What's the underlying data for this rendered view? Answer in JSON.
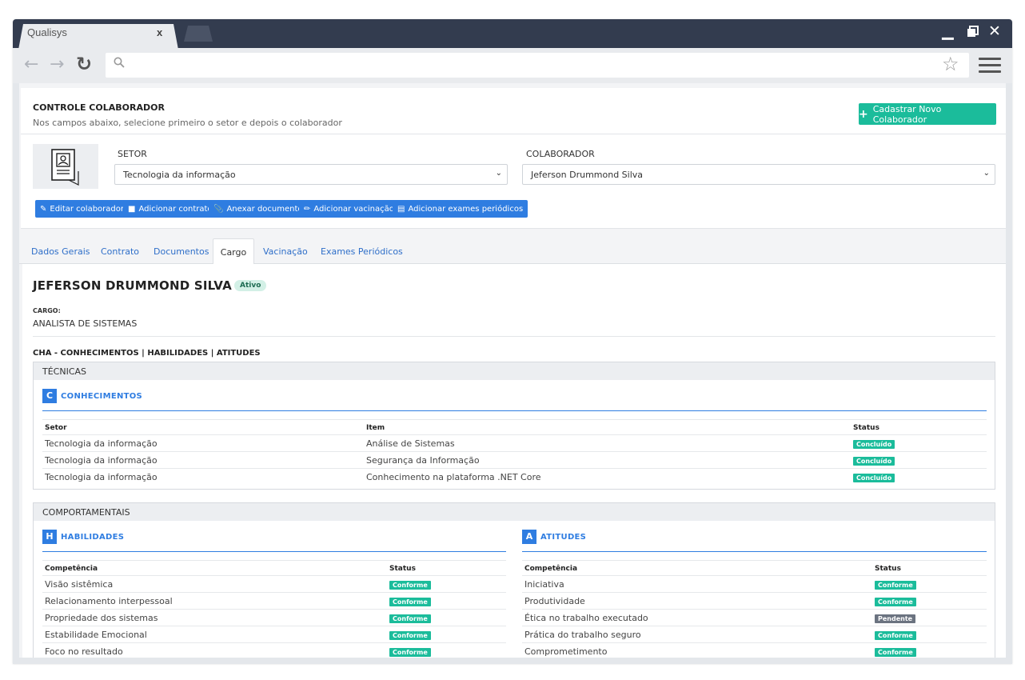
{
  "browser": {
    "tab_title": "Qualisys",
    "tab_close": "x",
    "search_icon": "search-icon"
  },
  "header": {
    "title": "CONTROLE COLABORADOR",
    "subtitle": "Nos campos abaixo, selecione primeiro o setor e depois o colaborador",
    "new_button": "Cadastrar Novo Colaborador"
  },
  "filters": {
    "setor_label": "SETOR",
    "setor_value": "Tecnologia da informação",
    "colaborador_label": "COLABORADOR",
    "colaborador_value": "Jeferson Drummond Silva"
  },
  "actions": [
    {
      "label": "Editar colaborador",
      "icon": "edit-icon"
    },
    {
      "label": "Adicionar contrato",
      "icon": "file-icon"
    },
    {
      "label": "Anexar documento",
      "icon": "paperclip-icon"
    },
    {
      "label": "Adicionar vacinação",
      "icon": "syringe-icon"
    },
    {
      "label": "Adicionar exames periódicos",
      "icon": "calendar-icon"
    }
  ],
  "tabs": [
    "Dados Gerais",
    "Contrato",
    "Documentos",
    "Cargo",
    "Vacinação",
    "Exames Periódicos"
  ],
  "active_tab": "Cargo",
  "employee": {
    "name": "JEFERSON DRUMMOND SILVA",
    "status": "Ativo",
    "cargo_label": "CARGO:",
    "cargo_value": "ANALISTA DE SISTEMAS"
  },
  "cha_title": "CHA - CONHECIMENTOS | HABILIDADES | ATITUDES",
  "tecnicas": {
    "title": "TÉCNICAS",
    "section_letter": "C",
    "section_name": "CONHECIMENTOS",
    "headers": [
      "Setor",
      "Item",
      "Status"
    ],
    "rows": [
      {
        "setor": "Tecnologia da informação",
        "item": "Análise de Sistemas",
        "status": "Concluído"
      },
      {
        "setor": "Tecnologia da informação",
        "item": "Segurança da Informação",
        "status": "Concluído"
      },
      {
        "setor": "Tecnologia da informação",
        "item": "Conhecimento na plataforma .NET Core",
        "status": "Concluído"
      }
    ]
  },
  "comportamentais": {
    "title": "COMPORTAMENTAIS",
    "habilidades": {
      "letter": "H",
      "name": "HABILIDADES",
      "headers": [
        "Competência",
        "Status"
      ],
      "rows": [
        {
          "competencia": "Visão sistêmica",
          "status": "Conforme"
        },
        {
          "competencia": "Relacionamento interpessoal",
          "status": "Conforme"
        },
        {
          "competencia": "Propriedade dos sistemas",
          "status": "Conforme"
        },
        {
          "competencia": "Estabilidade Emocional",
          "status": "Conforme"
        },
        {
          "competencia": "Foco no resultado",
          "status": "Conforme"
        }
      ]
    },
    "atitudes": {
      "letter": "A",
      "name": "ATITUDES",
      "headers": [
        "Competência",
        "Status"
      ],
      "rows": [
        {
          "competencia": "Iniciativa",
          "status": "Conforme"
        },
        {
          "competencia": "Produtividade",
          "status": "Conforme"
        },
        {
          "competencia": "Ética no trabalho executado",
          "status": "Pendente"
        },
        {
          "competencia": "Prática do trabalho seguro",
          "status": "Conforme"
        },
        {
          "competencia": "Comprometimento",
          "status": "Conforme"
        }
      ]
    }
  },
  "colors": {
    "accent_blue": "#2f7de1",
    "success_green": "#1bbc9b",
    "pending_gray": "#6b7380",
    "titlebar": "#333c4f"
  }
}
